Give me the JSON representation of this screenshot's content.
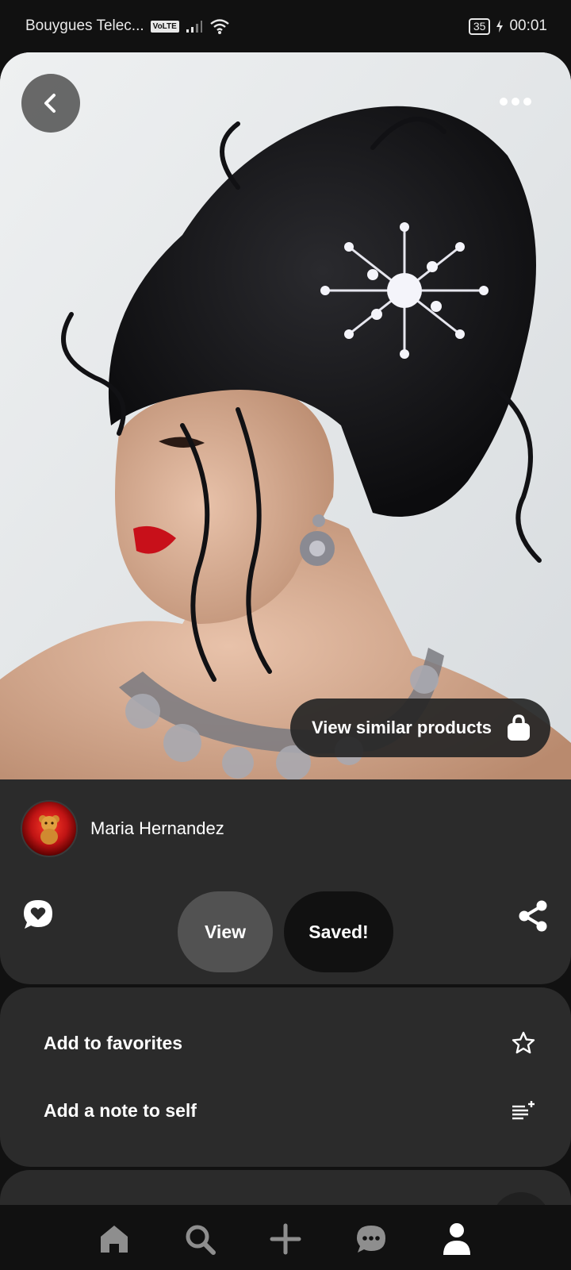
{
  "status_bar": {
    "carrier": "Bouygues Telec...",
    "network_badge": "VoLTE",
    "battery": "35",
    "time": "00:01"
  },
  "pin": {
    "back_icon": "chevron-left-icon",
    "more_icon": "more-horizontal-icon",
    "similar_label": "View similar products",
    "similar_icon": "shopping-bag-icon"
  },
  "creator": {
    "name": "Maria Hernandez"
  },
  "actions": {
    "comment_icon": "comment-heart-icon",
    "view_label": "View",
    "saved_label": "Saved!",
    "share_icon": "share-icon"
  },
  "options": [
    {
      "label": "Add to favorites",
      "icon": "star-icon"
    },
    {
      "label": "Add a note to self",
      "icon": "note-add-icon"
    }
  ],
  "nav": [
    {
      "name": "home",
      "icon": "home-icon"
    },
    {
      "name": "search",
      "icon": "search-icon"
    },
    {
      "name": "create",
      "icon": "plus-icon"
    },
    {
      "name": "messages",
      "icon": "chat-icon"
    },
    {
      "name": "profile",
      "icon": "profile-icon"
    }
  ],
  "colors": {
    "background": "#111111",
    "panel": "#2b2b2b",
    "view_button": "#525252",
    "saved_button": "#111111"
  }
}
